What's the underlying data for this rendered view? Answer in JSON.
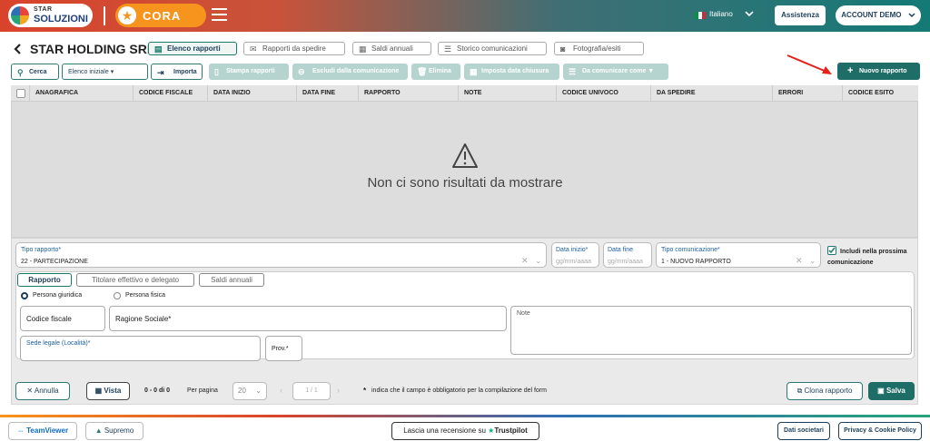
{
  "header": {
    "brand_top": "STAR",
    "brand_bottom": "SOLUZIONI",
    "app_name": "CORA",
    "language": "Italiano",
    "assistance_label": "Assistenza",
    "account_label": "ACCOUNT DEMO"
  },
  "page": {
    "title": "STAR HOLDING SRL",
    "tabs": [
      {
        "label": "Elenco rapporti",
        "icon": "list-icon"
      },
      {
        "label": "Rapporti da spedire",
        "icon": "mail-icon"
      },
      {
        "label": "Saldi annuali",
        "icon": "calendar-icon"
      },
      {
        "label": "Storico comunicazioni",
        "icon": "history-icon"
      },
      {
        "label": "Fotografia/esiti",
        "icon": "camera-icon"
      }
    ]
  },
  "toolbar": {
    "search_label": "Cerca",
    "initial_list_label": "Elenco iniziale",
    "import_label": "Importa",
    "print_label": "Stampa rapporti",
    "exclude_label": "Escludi dalla comunicazione",
    "delete_label": "Elimina",
    "closing_date_label": "Imposta data chiusura",
    "communicate_as_label": "Da comunicare come",
    "new_label": "Nuovo rapporto"
  },
  "table": {
    "columns": [
      "ANAGRAFICA",
      "CODICE FISCALE",
      "DATA INIZIO",
      "DATA FINE",
      "RAPPORTO",
      "NOTE",
      "CODICE UNIVOCO",
      "DA SPEDIRE",
      "ERRORI",
      "CODICE ESITO"
    ],
    "rows": [],
    "empty_message": "Non ci sono risultati da mostrare"
  },
  "form": {
    "tipo_rapporto_label": "Tipo rapporto*",
    "tipo_rapporto_value": "22 - PARTECIPAZIONE",
    "data_inizio_label": "Data inizio*",
    "data_inizio_placeholder": "gg/mm/aaaa",
    "data_fine_label": "Data fine",
    "data_fine_placeholder": "gg/mm/aaaa",
    "tipo_comunicazione_label": "Tipo comunicazione*",
    "tipo_comunicazione_value": "1 - NUOVO RAPPORTO",
    "include_label": "Includi nella prossima comunicazione",
    "include_checked": true,
    "subtabs": [
      "Rapporto",
      "Titolare effettivo e delegato",
      "Saldi annuali"
    ],
    "radio_options": [
      "Persona giuridica",
      "Persona fisica"
    ],
    "radio_selected": "Persona giuridica",
    "codice_fiscale_label": "Codice fiscale",
    "ragione_sociale_label": "Ragione Sociale*",
    "note_label": "Note",
    "sede_legale_label": "Sede legale (Località)*",
    "prov_label": "Prov.*"
  },
  "bottom": {
    "cancel_label": "Annulla",
    "view_label": "Vista",
    "count_text": "0 - 0 di 0",
    "per_page_label": "Per pagina",
    "per_page_value": "20",
    "page_text": "1 / 1",
    "required_note": "indica che il campo è obbligatorio per la compilazione del form",
    "required_mark": "*",
    "clone_label": "Clona rapporto",
    "save_label": "Salva"
  },
  "footer": {
    "teamviewer_label": "TeamViewer",
    "supremo_label": "Supremo",
    "review_label": "Lascia una recensione su",
    "trustpilot_label": "Trustpilot",
    "company_label": "Dati societari",
    "privacy_label": "Privacy & Cookie Policy"
  },
  "colors": {
    "accent": "#1e6d66",
    "brand_orange": "#f7941d",
    "annotation_red": "#e3231b"
  }
}
